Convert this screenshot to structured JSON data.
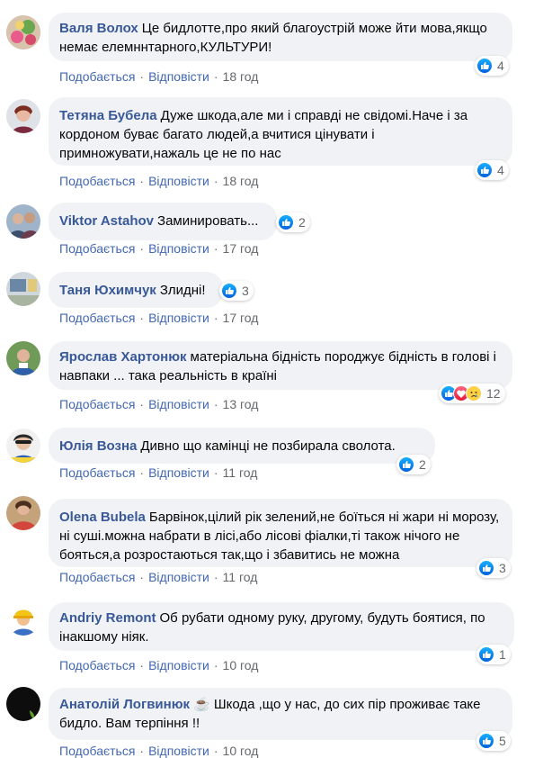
{
  "actions": {
    "like": "Подобається",
    "reply": "Відповісти",
    "separator": "·"
  },
  "colors": {
    "author": "#385898",
    "action": "#4267b2",
    "bubble": "#f0f2f5",
    "like": "#1877f2"
  },
  "comments": [
    {
      "author": "Валя Волох",
      "text": "Це бидлотте,про який благоустрій може йти мова,якщо немає елемннтарного,КУЛЬТУРИ!",
      "time": "18 год",
      "reactions": [
        "like-icon"
      ],
      "count": "4"
    },
    {
      "author": "Тетяна Бубела",
      "text": "Дуже шкода,але ми і справді не свідомі.Наче і за кордоном буває багато людей,а вчитися цінувати і примножувати,нажаль це не по нас",
      "time": "18 год",
      "reactions": [
        "like-icon"
      ],
      "count": "4"
    },
    {
      "author": "Viktor Astahov",
      "text": "Заминировать...",
      "time": "17 год",
      "reactions": [
        "like-icon"
      ],
      "count": "2"
    },
    {
      "author": "Таня Юхимчук",
      "text": "Злидні!",
      "time": "17 год",
      "reactions": [
        "like-icon"
      ],
      "count": "3"
    },
    {
      "author": "Ярослав Хартонюк",
      "text": "матеріальна бідність породжує бідність в голові і навпаки ... така реальність в країні",
      "time": "13 год",
      "reactions": [
        "like-icon",
        "love-icon",
        "sad-icon"
      ],
      "count": "12"
    },
    {
      "author": "Юлія Возна",
      "text": "Дивно що камінці не позбирала сволота.",
      "time": "11 год",
      "reactions": [
        "like-icon"
      ],
      "count": "2"
    },
    {
      "author": "Olena Bubela",
      "text": "Барвінок,цілий рік зелений,не боїться ні жари ні морозу, ні суші.можна набрати в лісі,або лісові фіалки,ті також нічого не бояться,а розростаються так,що і збавитись не можна",
      "time": "11 год",
      "reactions": [
        "like-icon"
      ],
      "count": "3"
    },
    {
      "author": "Andriy Remont",
      "text": "Об рубати одному руку, другому, будуть боятися, по інакшому ніяк.",
      "time": "10 год",
      "reactions": [
        "like-icon"
      ],
      "count": "1"
    },
    {
      "author": "Анатолій Логвинюк",
      "text": "☕ Шкода ,що у нас, до сих пір проживає таке бидло. Вам терпіння !!",
      "time": "10 год",
      "reactions": [
        "like-icon"
      ],
      "count": "5"
    }
  ]
}
